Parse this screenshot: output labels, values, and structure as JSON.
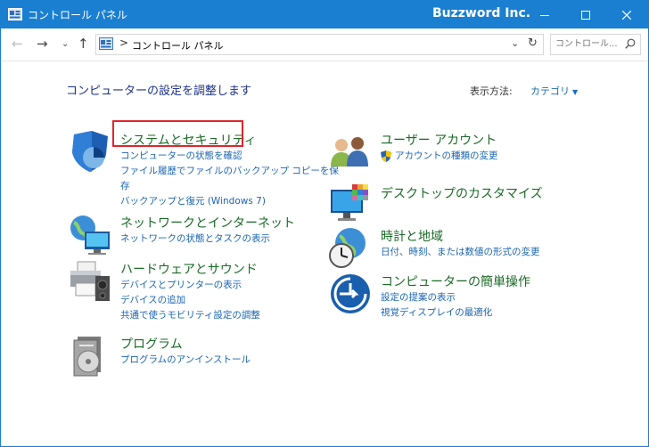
{
  "window": {
    "title": "コントロール パネル",
    "brand": "Buzzword Inc."
  },
  "address_bar": {
    "breadcrumb": "コントロール パネル",
    "separator": ">"
  },
  "search": {
    "placeholder": "コントロール..."
  },
  "main": {
    "heading": "コンピューターの設定を調整します",
    "view_by_label": "表示方法:",
    "view_by_value": "カテゴリ"
  },
  "categories": [
    {
      "title": "システムとセキュリティ",
      "icon": "shield-security-icon",
      "links": [
        "コンピューターの状態を確認",
        "ファイル履歴でファイルのバックアップ コピーを保",
        "存",
        "バックアップと復元 (Windows 7)"
      ]
    },
    {
      "title": "ネットワークとインターネット",
      "icon": "network-globe-icon",
      "links": [
        "ネットワークの状態とタスクの表示"
      ]
    },
    {
      "title": "ハードウェアとサウンド",
      "icon": "printer-speaker-icon",
      "links": [
        "デバイスとプリンターの表示",
        "デバイスの追加",
        "共通で使うモビリティ設定の調整"
      ]
    },
    {
      "title": "プログラム",
      "icon": "programs-disc-icon",
      "links": [
        "プログラムのアンインストール"
      ]
    },
    {
      "title": "ユーザー アカウント",
      "icon": "users-icon",
      "links": [
        "アカウントの種類の変更"
      ]
    },
    {
      "title": "デスクトップのカスタマイズ",
      "icon": "monitor-desktop-icon",
      "links": []
    },
    {
      "title": "時計と地域",
      "icon": "clock-globe-icon",
      "links": [
        "日付、時刻、または数値の形式の変更"
      ]
    },
    {
      "title": "コンピューターの簡単操作",
      "icon": "ease-of-access-icon",
      "links": [
        "設定の提案の表示",
        "視覚ディスプレイの最適化"
      ]
    }
  ],
  "colors": {
    "titlebar": "#1a7fd1",
    "category_title": "#1a6b26",
    "link": "#1a64b4",
    "heading": "#1e3287",
    "highlight": "#e3242b"
  }
}
